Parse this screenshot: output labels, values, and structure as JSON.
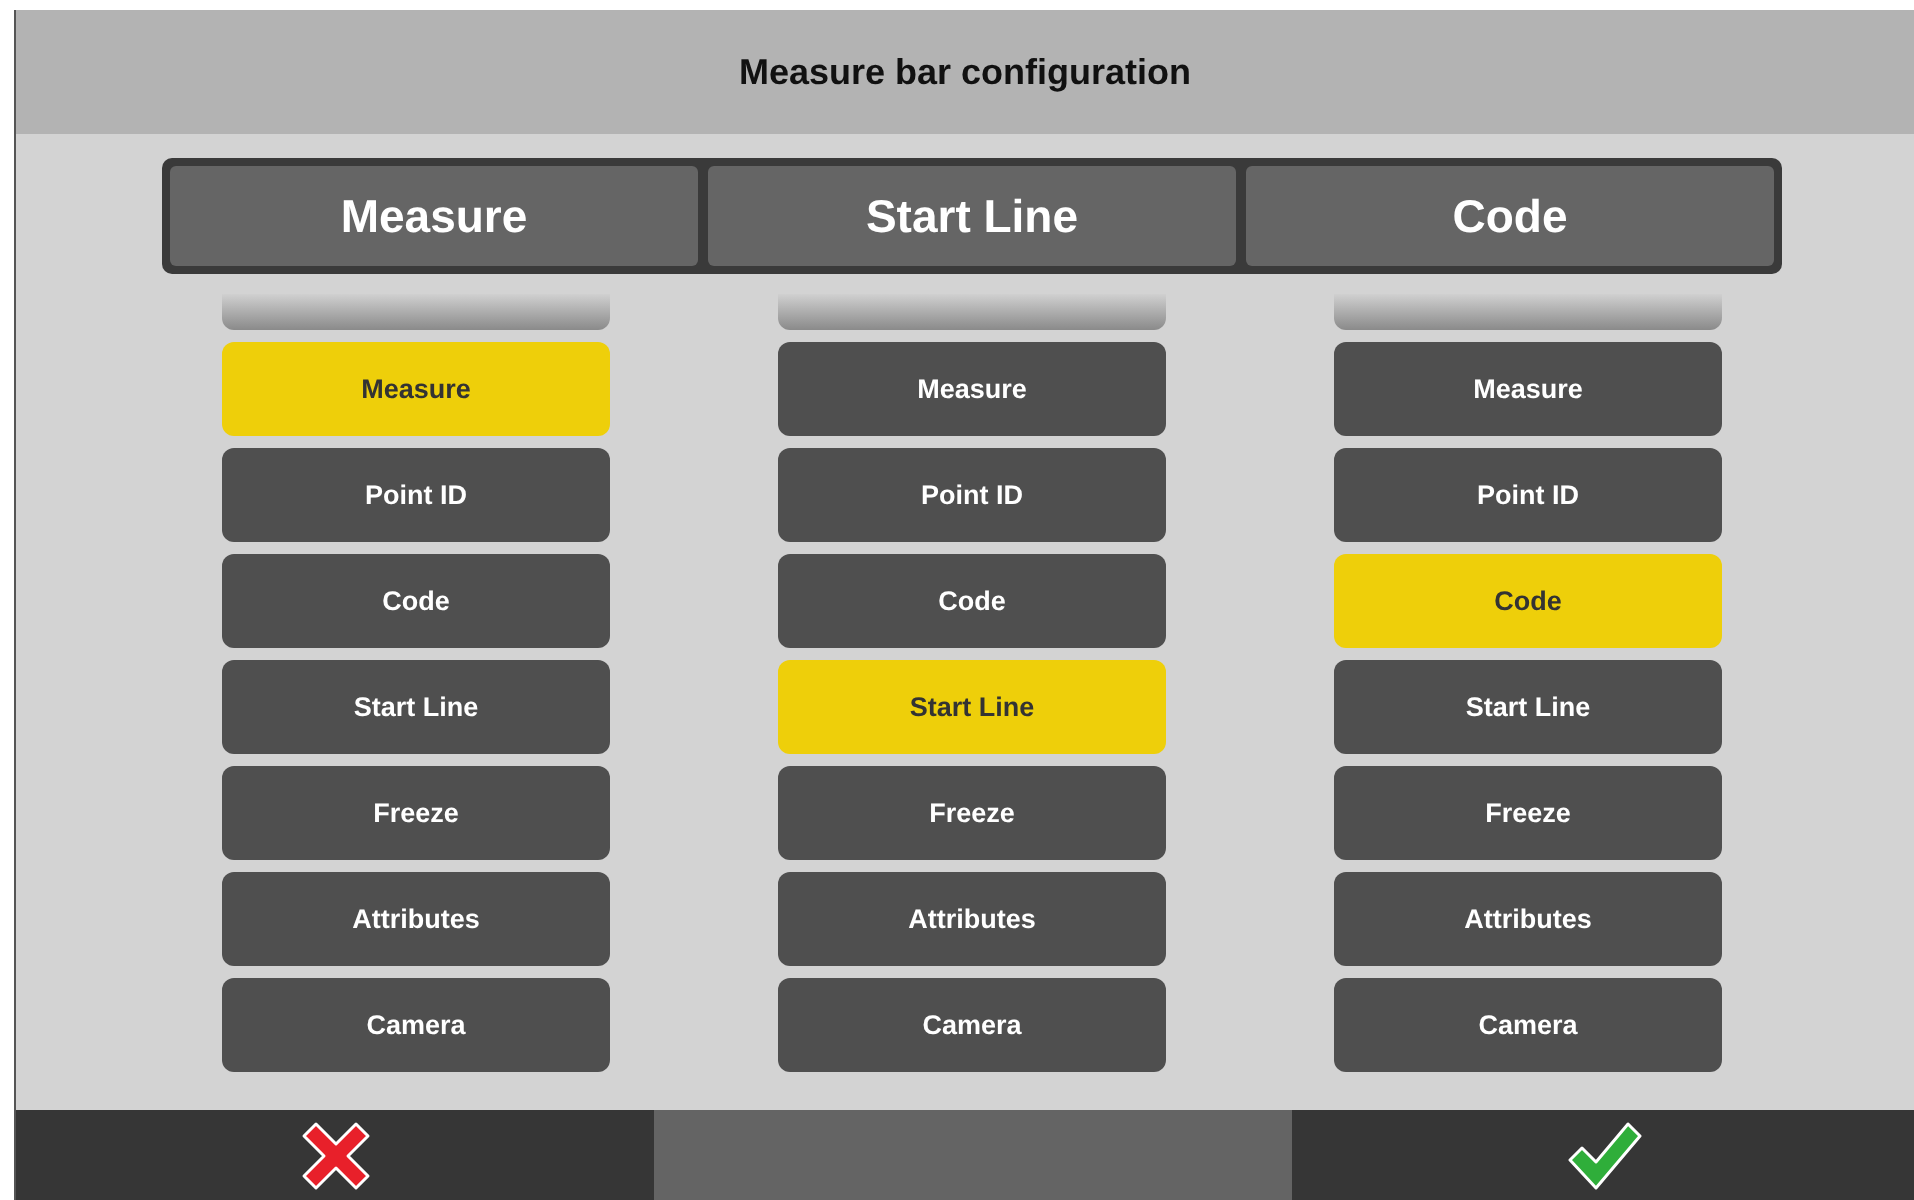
{
  "window": {
    "title": "Measure bar configuration"
  },
  "slots": [
    {
      "label": "Measure"
    },
    {
      "label": "Start Line"
    },
    {
      "label": "Code"
    }
  ],
  "columns": [
    {
      "options": [
        {
          "label": "Measure",
          "selected": true
        },
        {
          "label": "Point ID",
          "selected": false
        },
        {
          "label": "Code",
          "selected": false
        },
        {
          "label": "Start Line",
          "selected": false
        },
        {
          "label": "Freeze",
          "selected": false
        },
        {
          "label": "Attributes",
          "selected": false
        },
        {
          "label": "Camera",
          "selected": false
        }
      ]
    },
    {
      "options": [
        {
          "label": "Measure",
          "selected": false
        },
        {
          "label": "Point ID",
          "selected": false
        },
        {
          "label": "Code",
          "selected": false
        },
        {
          "label": "Start Line",
          "selected": true
        },
        {
          "label": "Freeze",
          "selected": false
        },
        {
          "label": "Attributes",
          "selected": false
        },
        {
          "label": "Camera",
          "selected": false
        }
      ]
    },
    {
      "options": [
        {
          "label": "Measure",
          "selected": false
        },
        {
          "label": "Point ID",
          "selected": false
        },
        {
          "label": "Code",
          "selected": true
        },
        {
          "label": "Start Line",
          "selected": false
        },
        {
          "label": "Freeze",
          "selected": false
        },
        {
          "label": "Attributes",
          "selected": false
        },
        {
          "label": "Camera",
          "selected": false
        }
      ]
    }
  ],
  "footer": [
    {
      "kind": "cancel"
    },
    {
      "kind": "blank"
    },
    {
      "kind": "confirm"
    }
  ]
}
